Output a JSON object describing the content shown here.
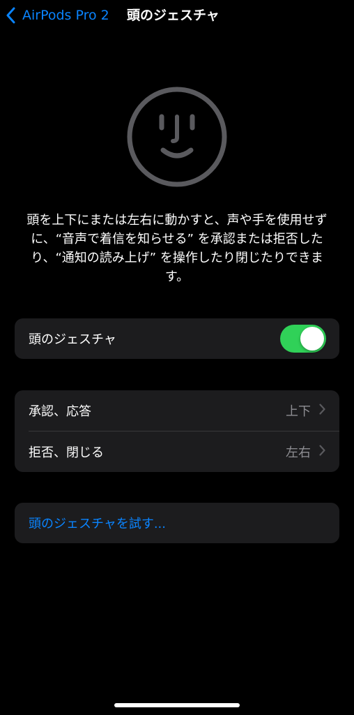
{
  "nav": {
    "back_label": "AirPods Pro 2",
    "title": "頭のジェスチャ"
  },
  "illustration": {
    "icon": "face-icon"
  },
  "description": "頭を上下にまたは左右に動かすと、声や手を使用せずに、“音声で着信を知らせる” を承認または拒否したり、“通知の読み上げ” を操作したり閉じたりできます。",
  "toggle_section": {
    "label": "頭のジェスチャ",
    "enabled": true
  },
  "gestures": [
    {
      "label": "承認、応答",
      "value": "上下"
    },
    {
      "label": "拒否、閉じる",
      "value": "左右"
    }
  ],
  "try_link": {
    "label": "頭のジェスチャを試す..."
  },
  "colors": {
    "accent": "#0a84ff",
    "toggle_on": "#30d158",
    "group_bg": "#1c1c1e",
    "secondary_text": "#8e8e93"
  }
}
